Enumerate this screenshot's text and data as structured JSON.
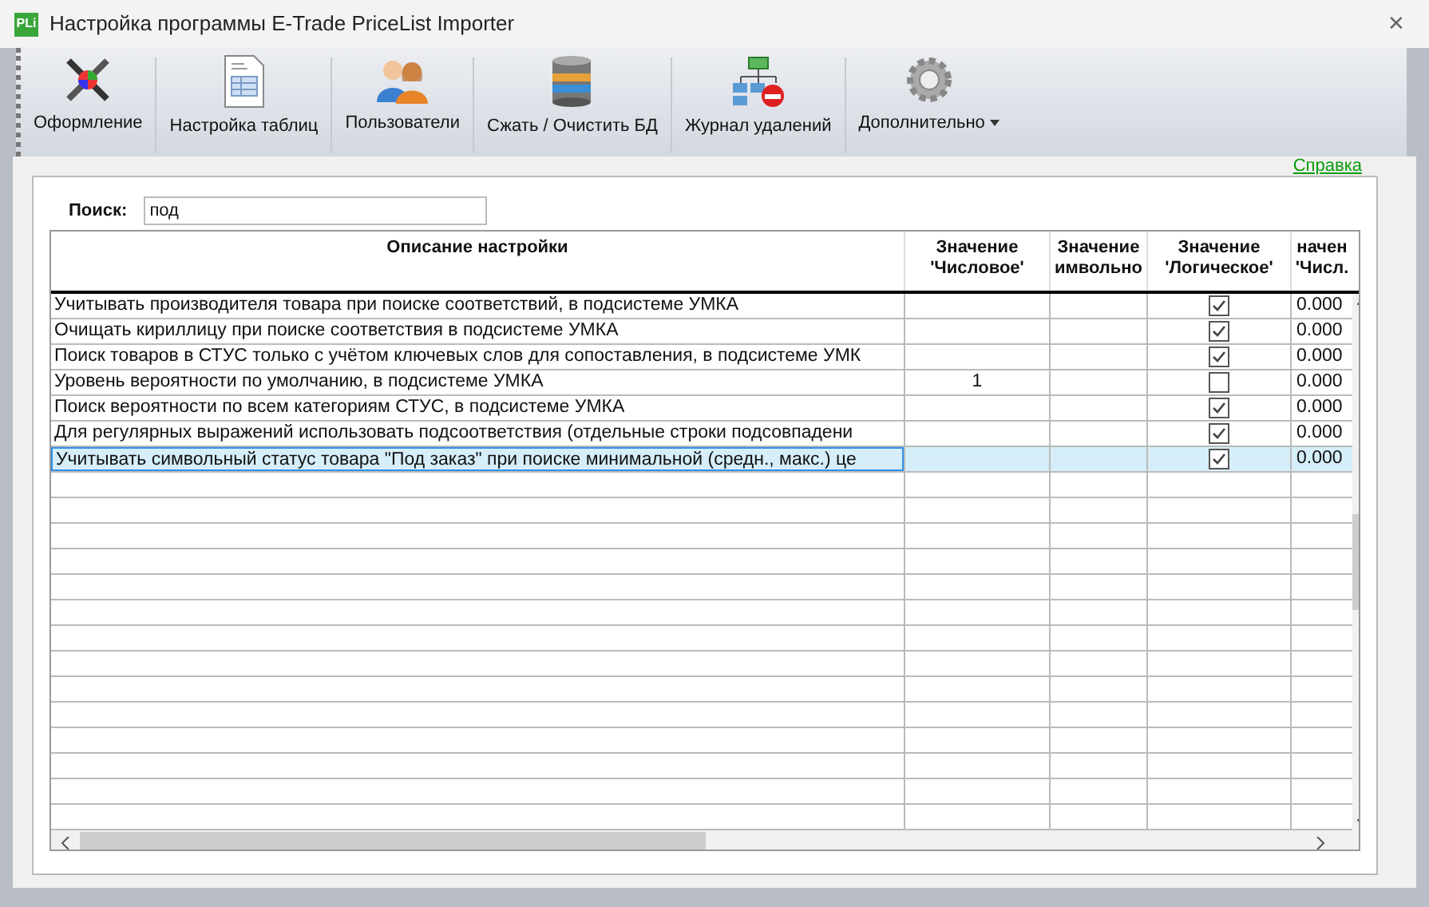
{
  "window": {
    "title": "Настройка программы E-Trade PriceList Importer",
    "app_badge": "PLi",
    "close": "✕"
  },
  "toolbar": [
    {
      "label": "Оформление",
      "kind": "tools",
      "dropdown": false
    },
    {
      "label": "Настройка таблиц",
      "kind": "sheet",
      "dropdown": false
    },
    {
      "label": "Пользователи",
      "kind": "users",
      "dropdown": false
    },
    {
      "label": "Сжать / Очистить БД",
      "kind": "database",
      "dropdown": false
    },
    {
      "label": "Журнал удалений",
      "kind": "log",
      "dropdown": false
    },
    {
      "label": "Дополнительно",
      "kind": "gear",
      "dropdown": true
    }
  ],
  "help_link": "Справка",
  "search": {
    "label": "Поиск:",
    "value": "под"
  },
  "table": {
    "columns": [
      {
        "lines": [
          "Описание настройки"
        ]
      },
      {
        "lines": [
          "Значение",
          "'Числовое'"
        ]
      },
      {
        "lines": [
          "Значение",
          "имвольно"
        ]
      },
      {
        "lines": [
          "Значение",
          "'Логическое'"
        ]
      },
      {
        "lines": [
          "начен",
          "'Числ."
        ]
      }
    ],
    "rows": [
      {
        "description": "Учитывать производителя товара при поиске соответствий, в подсистеме УМКА",
        "numeric": "",
        "checked": true,
        "column_5": "0.000",
        "selected": false
      },
      {
        "description": "Очищать кириллицу при поиске соответствия в подсистеме УМКА",
        "numeric": "",
        "checked": true,
        "column_5": "0.000",
        "selected": false
      },
      {
        "description": "Поиск товаров в СТУС только с учётом ключевых слов для сопоставления, в подсистеме УМК",
        "numeric": "",
        "checked": true,
        "column_5": "0.000",
        "selected": false
      },
      {
        "description": "Уровень вероятности по умолчанию, в подсистеме УМКА",
        "numeric": "1",
        "checked": false,
        "column_5": "0.000",
        "selected": false
      },
      {
        "description": "Поиск вероятности по всем категориям СТУС, в подсистеме УМКА",
        "numeric": "",
        "checked": true,
        "column_5": "0.000",
        "selected": false
      },
      {
        "description": "Для регулярных выражений использовать подсоответствия (отдельные строки подсовпадени",
        "numeric": "",
        "checked": true,
        "column_5": "0.000",
        "selected": false
      },
      {
        "description": "Учитывать символьный статус товара \"Под заказ\" при поиске минимальной (средн., макс.) це",
        "numeric": "",
        "checked": true,
        "column_5": "0.000",
        "selected": true
      }
    ]
  }
}
